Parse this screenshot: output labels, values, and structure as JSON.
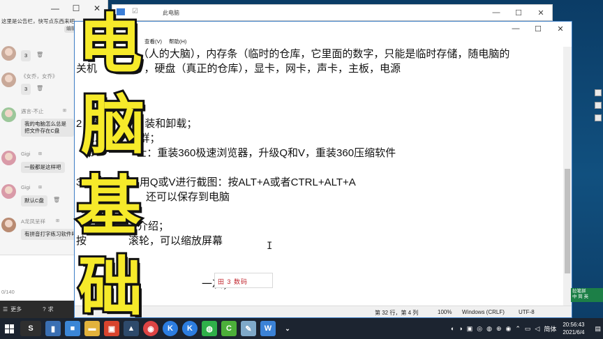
{
  "chat": {
    "notice": "这里是公告栏，快写点东西来吧~",
    "edit_chip": "编辑",
    "messages": [
      {
        "name": "",
        "text": "3"
      },
      {
        "name": "《女乔，女乔》",
        "text": "3"
      },
      {
        "name": "遇言-不止",
        "text": "我的电脑怎么总是把文件存在C盘"
      },
      {
        "name": "Gigi",
        "text": "一般都是这样吧"
      },
      {
        "name": "Gigi",
        "text": "默认C盘"
      },
      {
        "name": "A龙凤呈祥",
        "text": "有拼音打字练习软件吗"
      }
    ],
    "counter": "0/140",
    "more_label": "更多",
    "request_label": "求"
  },
  "explorer": {
    "title": "此电脑"
  },
  "notepad": {
    "menu": [
      "查看(V)",
      "帮助(H)"
    ],
    "lines": [
      "U（人的大脑），内存条（临时的仓库，它里面的数字，只能是临时存储，随电脑的",
      "关机　　　失），硬盘（真正的仓库），显卡，网卡，声卡，主板，电源",
      "2，常　　　　装和卸载；",
      "a.　　　　群；",
      "b　　　　士：重装360极速浏览器，升级Q和V，重装360压缩软件",
      "3，截图，　以用Q或V进行截图：按ALT+A或者CTRL+ALT+A",
      "还可以保存到电脑",
      "介绍；",
      "按　　　　滚轮，可以缩放屏幕",
      "一次；"
    ],
    "stamp_text": "田 3 数码",
    "status": {
      "position": "第 32 行，第 4 列",
      "zoom": "100%",
      "eol": "Windows (CRLF)",
      "encoding": "UTF-8"
    }
  },
  "overlay": {
    "chars": [
      "电",
      "脑",
      "基",
      "础"
    ],
    "color": "#f6ea2a"
  },
  "ime": {
    "line1": "拉笔拼",
    "line2": "中 简 英"
  },
  "taskbar": {
    "lang": "简体",
    "time": "20:56:43",
    "date": "2021/6/4"
  }
}
